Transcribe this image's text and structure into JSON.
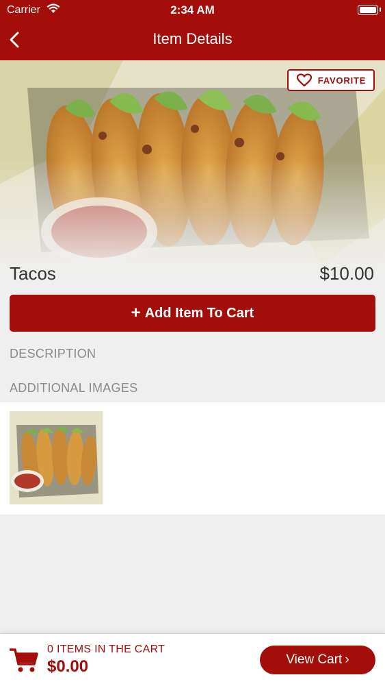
{
  "status_bar": {
    "carrier": "Carrier",
    "time": "2:34 AM"
  },
  "nav": {
    "title": "Item Details",
    "back_icon": "chevron-left-icon"
  },
  "favorite": {
    "label": "FAVORITE",
    "icon": "heart-icon"
  },
  "item": {
    "name": "Tacos",
    "price": "$10.00"
  },
  "add_to_cart": {
    "plus": "+",
    "label": "Add Item To Cart"
  },
  "sections": {
    "description": "DESCRIPTION",
    "additional_images": "ADDITIONAL IMAGES"
  },
  "cart_bar": {
    "count_text": "0 ITEMS IN THE CART",
    "total": "$0.00",
    "view_cart_label": "View Cart",
    "view_cart_chevron": "›",
    "cart_icon": "shopping-cart-icon"
  },
  "colors": {
    "accent": "#a30d0a",
    "background": "#efefef"
  }
}
